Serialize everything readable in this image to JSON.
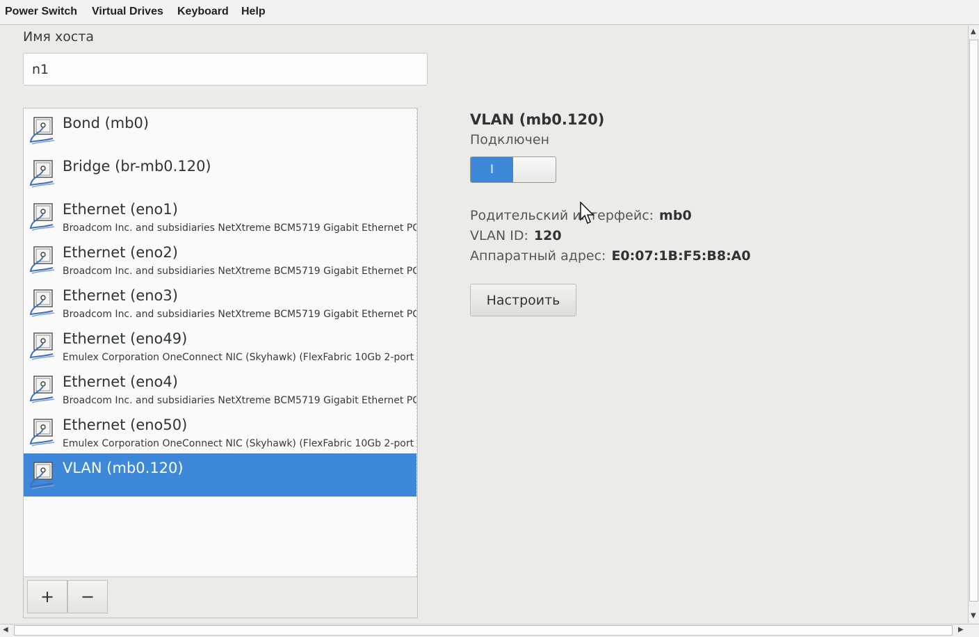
{
  "menu": {
    "items": [
      {
        "label": "Power Switch"
      },
      {
        "label": "Virtual Drives"
      },
      {
        "label": "Keyboard"
      },
      {
        "label": "Help"
      }
    ]
  },
  "hostname": {
    "label": "Имя хоста",
    "value": "n1"
  },
  "devices": [
    {
      "title": "Bond (mb0)",
      "subtitle": "",
      "selected": false
    },
    {
      "title": "Bridge (br-mb0.120)",
      "subtitle": "",
      "selected": false
    },
    {
      "title": "Ethernet (eno1)",
      "subtitle": "Broadcom Inc. and subsidiaries NetXtreme BCM5719 Gigabit Ethernet PC",
      "selected": false
    },
    {
      "title": "Ethernet (eno2)",
      "subtitle": "Broadcom Inc. and subsidiaries NetXtreme BCM5719 Gigabit Ethernet PC",
      "selected": false
    },
    {
      "title": "Ethernet (eno3)",
      "subtitle": "Broadcom Inc. and subsidiaries NetXtreme BCM5719 Gigabit Ethernet PC",
      "selected": false
    },
    {
      "title": "Ethernet (eno49)",
      "subtitle": "Emulex Corporation OneConnect NIC (Skyhawk) (FlexFabric 10Gb 2-port",
      "selected": false
    },
    {
      "title": "Ethernet (eno4)",
      "subtitle": "Broadcom Inc. and subsidiaries NetXtreme BCM5719 Gigabit Ethernet PC",
      "selected": false
    },
    {
      "title": "Ethernet (eno50)",
      "subtitle": "Emulex Corporation OneConnect NIC (Skyhawk) (FlexFabric 10Gb 2-port",
      "selected": false
    },
    {
      "title": "VLAN (mb0.120)",
      "subtitle": "",
      "selected": true
    }
  ],
  "list_buttons": {
    "add": "+",
    "remove": "−"
  },
  "detail": {
    "title": "VLAN (mb0.120)",
    "status": "Подключен",
    "switch_on_label": "I",
    "switch_on": true,
    "parent_label": "Родительский интерфейс:",
    "parent_value": "mb0",
    "vlan_label": "VLAN ID:",
    "vlan_value": "120",
    "hw_label": "Аппаратный адрес:",
    "hw_value": "E0:07:1B:F5:B8:A0",
    "configure": "Настроить"
  },
  "colors": {
    "accent": "#3d88d9",
    "background": "#ecebe7"
  }
}
